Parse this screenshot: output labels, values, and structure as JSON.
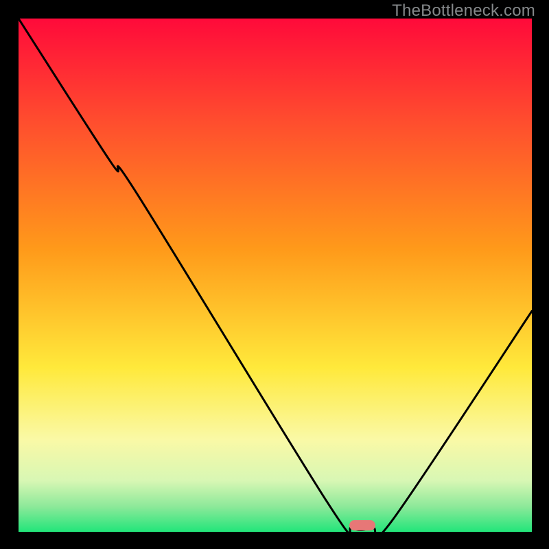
{
  "watermark": "TheBottleneck.com",
  "colors": {
    "black": "#000000",
    "red_top": "#ff0a3a",
    "orange": "#ff9a1a",
    "yellow": "#ffe93b",
    "yellow_pale": "#faf9a6",
    "green_pale": "#b7f39e",
    "green": "#22e57a",
    "marker_fill": "#e77777",
    "curve": "#000000",
    "wm_gray": "#85888a"
  },
  "chart_data": {
    "type": "line",
    "title": "",
    "xlabel": "",
    "ylabel": "",
    "xlim": [
      0,
      100
    ],
    "ylim": [
      0,
      100
    ],
    "grid": false,
    "legend": false,
    "curve_points": [
      {
        "x": 0.0,
        "y": 100.0
      },
      {
        "x": 18.0,
        "y": 72.0
      },
      {
        "x": 23.0,
        "y": 66.0
      },
      {
        "x": 60.0,
        "y": 6.0
      },
      {
        "x": 65.0,
        "y": 0.8
      },
      {
        "x": 69.0,
        "y": 0.8
      },
      {
        "x": 73.0,
        "y": 2.5
      },
      {
        "x": 100.0,
        "y": 43.0
      }
    ],
    "marker": {
      "x_center": 67.0,
      "y_center": 1.3,
      "width_pct": 5.0,
      "height_pct": 2.0
    },
    "gradient_stops": [
      {
        "pct": 0,
        "color": "#ff0a3a"
      },
      {
        "pct": 20,
        "color": "#ff4d2e"
      },
      {
        "pct": 45,
        "color": "#ff9a1a"
      },
      {
        "pct": 68,
        "color": "#ffe93b"
      },
      {
        "pct": 82,
        "color": "#faf9a6"
      },
      {
        "pct": 90,
        "color": "#d8f7b4"
      },
      {
        "pct": 95,
        "color": "#8ee99a"
      },
      {
        "pct": 100,
        "color": "#22e57a"
      }
    ]
  }
}
